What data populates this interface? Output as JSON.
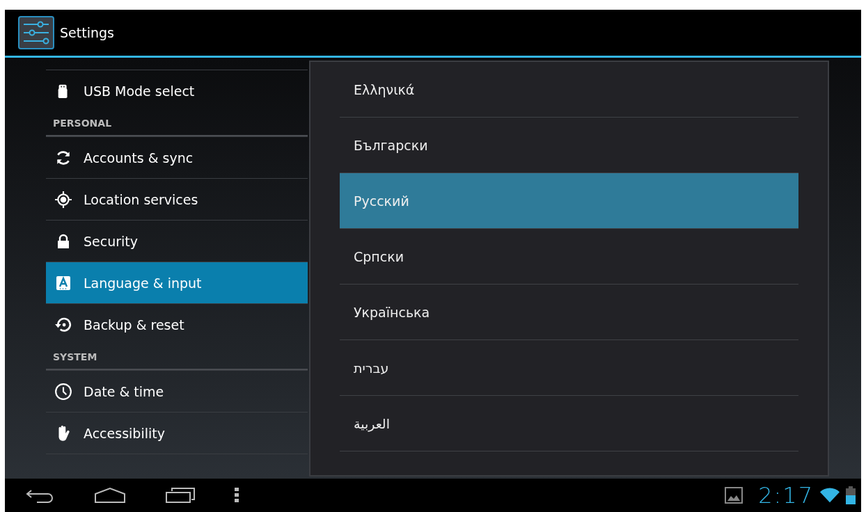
{
  "action_bar": {
    "title": "Settings"
  },
  "settings_list": [
    {
      "kind": "item",
      "label": "USB Mode select",
      "selected": false
    },
    {
      "kind": "header",
      "label": "PERSONAL"
    },
    {
      "kind": "item",
      "label": "Accounts & sync",
      "selected": false
    },
    {
      "kind": "item",
      "label": "Location services",
      "selected": false
    },
    {
      "kind": "item",
      "label": "Security",
      "selected": false
    },
    {
      "kind": "item",
      "label": "Language & input",
      "selected": true
    },
    {
      "kind": "item",
      "label": "Backup & reset",
      "selected": false
    },
    {
      "kind": "header",
      "label": "SYSTEM"
    },
    {
      "kind": "item",
      "label": "Date & time",
      "selected": false
    },
    {
      "kind": "item",
      "label": "Accessibility",
      "selected": false
    }
  ],
  "language_dialog": {
    "options": [
      {
        "label": "Ελληνικά",
        "selected": false
      },
      {
        "label": "Български",
        "selected": false
      },
      {
        "label": "Русский",
        "selected": true
      },
      {
        "label": "Српски",
        "selected": false
      },
      {
        "label": "Українська",
        "selected": false
      },
      {
        "label": "עברית",
        "selected": false
      },
      {
        "label": "العربية",
        "selected": false
      }
    ]
  },
  "status_bar": {
    "time": "2:17"
  }
}
